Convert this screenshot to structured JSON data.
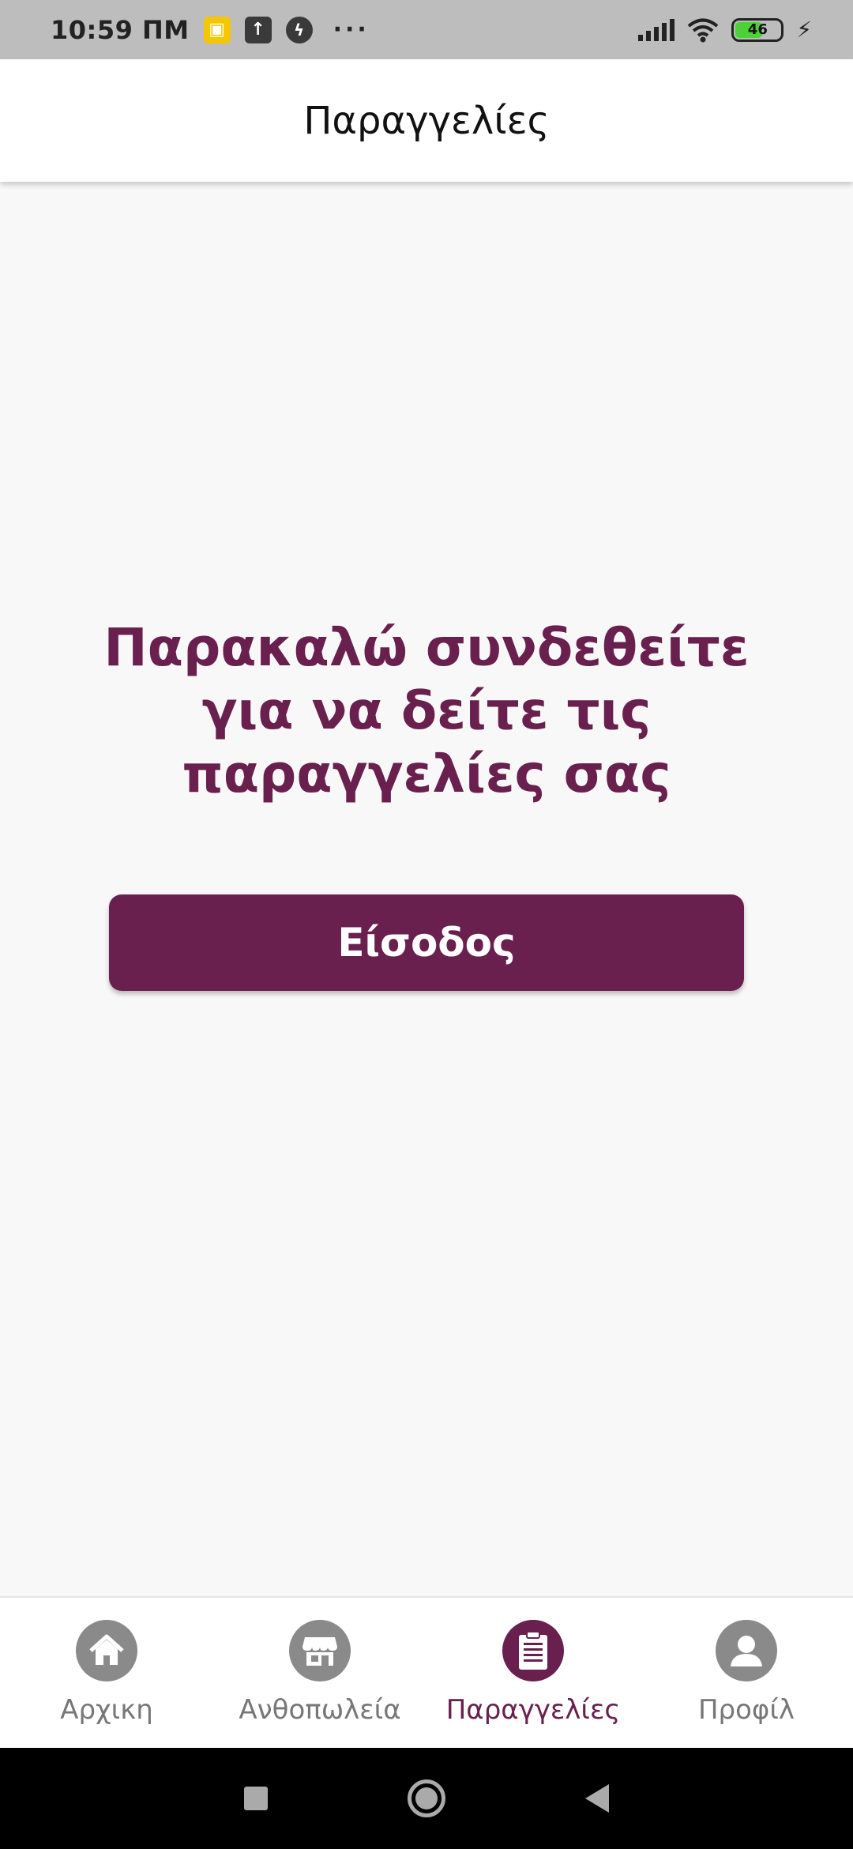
{
  "status_bar": {
    "time": "10:59 ΠΜ",
    "battery_level": "46",
    "icons": [
      "notification-app-icon",
      "upload-icon",
      "messenger-icon",
      "more-dots-icon",
      "signal-icon",
      "wifi-icon",
      "battery-icon",
      "charging-icon"
    ]
  },
  "header": {
    "title": "Παραγγελίες"
  },
  "main": {
    "message": "Παρακαλώ συνδεθείτε για να δείτε τις παραγγελίες σας",
    "login_button_label": "Είσοδος"
  },
  "bottom_nav": {
    "items": [
      {
        "label": "Αρχικη",
        "icon": "home-icon",
        "active": false
      },
      {
        "label": "Ανθοπωλεία",
        "icon": "store-icon",
        "active": false
      },
      {
        "label": "Παραγγελίες",
        "icon": "orders-clipboard-icon",
        "active": true
      },
      {
        "label": "Προφίλ",
        "icon": "profile-icon",
        "active": false
      }
    ]
  },
  "colors": {
    "brand": "#69204e",
    "inactive": "#8a8a8a",
    "background": "#f8f8f8"
  }
}
